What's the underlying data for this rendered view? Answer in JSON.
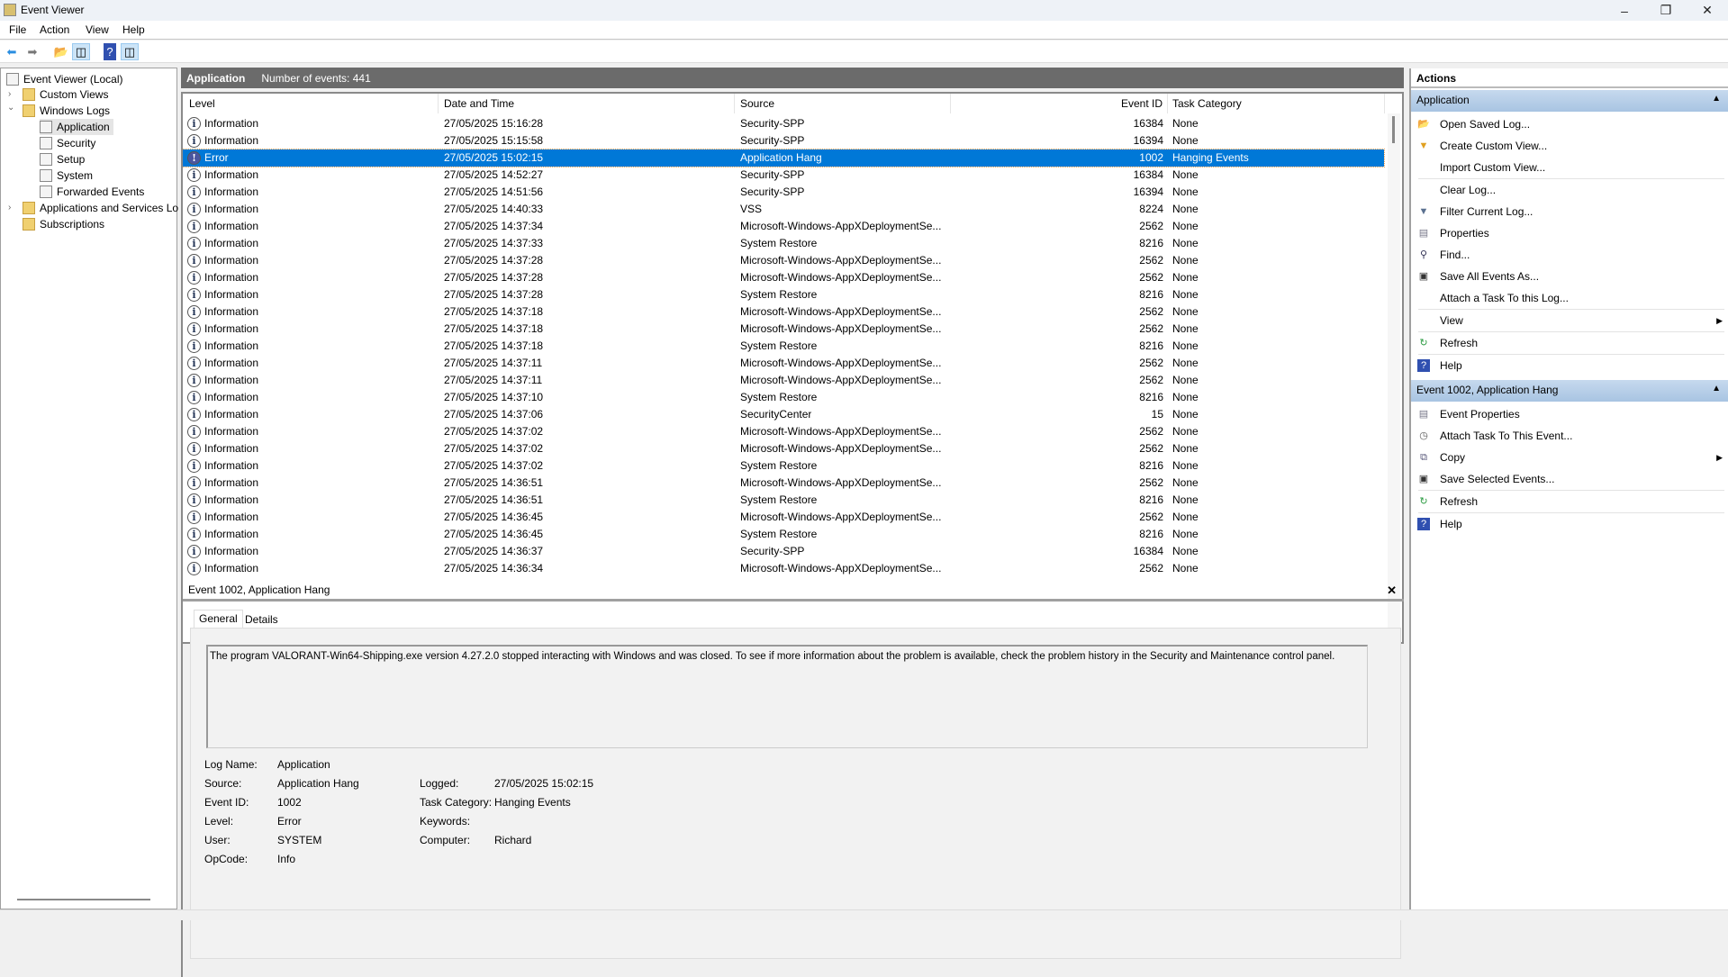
{
  "window": {
    "title": "Event Viewer"
  },
  "menu": [
    "File",
    "Action",
    "View",
    "Help"
  ],
  "tree": {
    "root": "Event Viewer (Local)",
    "custom_views": "Custom Views",
    "windows_logs": "Windows Logs",
    "logs": [
      "Application",
      "Security",
      "Setup",
      "System",
      "Forwarded Events"
    ],
    "apps_services": "Applications and Services Lo",
    "subscriptions": "Subscriptions"
  },
  "log_header": {
    "name": "Application",
    "count_label": "Number of events: 441"
  },
  "columns": [
    "Level",
    "Date and Time",
    "Source",
    "Event ID",
    "Task Category"
  ],
  "rows": [
    [
      "Information",
      "27/05/2025 15:16:28",
      "Security-SPP",
      "16384",
      "None"
    ],
    [
      "Information",
      "27/05/2025 15:15:58",
      "Security-SPP",
      "16394",
      "None"
    ],
    [
      "Error",
      "27/05/2025 15:02:15",
      "Application Hang",
      "1002",
      "Hanging Events"
    ],
    [
      "Information",
      "27/05/2025 14:52:27",
      "Security-SPP",
      "16384",
      "None"
    ],
    [
      "Information",
      "27/05/2025 14:51:56",
      "Security-SPP",
      "16394",
      "None"
    ],
    [
      "Information",
      "27/05/2025 14:40:33",
      "VSS",
      "8224",
      "None"
    ],
    [
      "Information",
      "27/05/2025 14:37:34",
      "Microsoft-Windows-AppXDeploymentSe...",
      "2562",
      "None"
    ],
    [
      "Information",
      "27/05/2025 14:37:33",
      "System Restore",
      "8216",
      "None"
    ],
    [
      "Information",
      "27/05/2025 14:37:28",
      "Microsoft-Windows-AppXDeploymentSe...",
      "2562",
      "None"
    ],
    [
      "Information",
      "27/05/2025 14:37:28",
      "Microsoft-Windows-AppXDeploymentSe...",
      "2562",
      "None"
    ],
    [
      "Information",
      "27/05/2025 14:37:28",
      "System Restore",
      "8216",
      "None"
    ],
    [
      "Information",
      "27/05/2025 14:37:18",
      "Microsoft-Windows-AppXDeploymentSe...",
      "2562",
      "None"
    ],
    [
      "Information",
      "27/05/2025 14:37:18",
      "Microsoft-Windows-AppXDeploymentSe...",
      "2562",
      "None"
    ],
    [
      "Information",
      "27/05/2025 14:37:18",
      "System Restore",
      "8216",
      "None"
    ],
    [
      "Information",
      "27/05/2025 14:37:11",
      "Microsoft-Windows-AppXDeploymentSe...",
      "2562",
      "None"
    ],
    [
      "Information",
      "27/05/2025 14:37:11",
      "Microsoft-Windows-AppXDeploymentSe...",
      "2562",
      "None"
    ],
    [
      "Information",
      "27/05/2025 14:37:10",
      "System Restore",
      "8216",
      "None"
    ],
    [
      "Information",
      "27/05/2025 14:37:06",
      "SecurityCenter",
      "15",
      "None"
    ],
    [
      "Information",
      "27/05/2025 14:37:02",
      "Microsoft-Windows-AppXDeploymentSe...",
      "2562",
      "None"
    ],
    [
      "Information",
      "27/05/2025 14:37:02",
      "Microsoft-Windows-AppXDeploymentSe...",
      "2562",
      "None"
    ],
    [
      "Information",
      "27/05/2025 14:37:02",
      "System Restore",
      "8216",
      "None"
    ],
    [
      "Information",
      "27/05/2025 14:36:51",
      "Microsoft-Windows-AppXDeploymentSe...",
      "2562",
      "None"
    ],
    [
      "Information",
      "27/05/2025 14:36:51",
      "System Restore",
      "8216",
      "None"
    ],
    [
      "Information",
      "27/05/2025 14:36:45",
      "Microsoft-Windows-AppXDeploymentSe...",
      "2562",
      "None"
    ],
    [
      "Information",
      "27/05/2025 14:36:45",
      "System Restore",
      "8216",
      "None"
    ],
    [
      "Information",
      "27/05/2025 14:36:37",
      "Security-SPP",
      "16384",
      "None"
    ],
    [
      "Information",
      "27/05/2025 14:36:34",
      "Microsoft-Windows-AppXDeploymentSe...",
      "2562",
      "None"
    ]
  ],
  "selected_row": 2,
  "detail": {
    "title": "Event 1002, Application Hang",
    "close": "✕",
    "tabs": [
      "General",
      "Details"
    ],
    "message": "The program VALORANT-Win64-Shipping.exe version 4.27.2.0 stopped interacting with Windows and was closed. To see if more information about the problem is available, check the problem history in the Security and Maintenance control panel.",
    "fields": {
      "log_name_label": "Log Name:",
      "log_name": "Application",
      "source_label": "Source:",
      "source": "Application Hang",
      "logged_label": "Logged:",
      "logged": "27/05/2025 15:02:15",
      "event_id_label": "Event ID:",
      "event_id": "1002",
      "task_category_label": "Task Category:",
      "task_category": "Hanging Events",
      "level_label": "Level:",
      "level": "Error",
      "keywords_label": "Keywords:",
      "keywords": "",
      "user_label": "User:",
      "user": "SYSTEM",
      "computer_label": "Computer:",
      "computer": "Richard",
      "opcode_label": "OpCode:",
      "opcode": "Info"
    }
  },
  "actions": {
    "title": "Actions",
    "group1": {
      "title": "Application",
      "items": [
        "Open Saved Log...",
        "Create Custom View...",
        "Import Custom View...",
        "Clear Log...",
        "Filter Current Log...",
        "Properties",
        "Find...",
        "Save All Events As...",
        "Attach a Task To this Log...",
        "View",
        "Refresh",
        "Help"
      ]
    },
    "group2": {
      "title": "Event 1002, Application Hang",
      "items": [
        "Event Properties",
        "Attach Task To This Event...",
        "Copy",
        "Save Selected Events...",
        "Refresh",
        "Help"
      ]
    }
  },
  "colors": {
    "selection": "#0078d7",
    "header_bar": "#6b6b6b",
    "group_header": "#b8cfe8"
  }
}
